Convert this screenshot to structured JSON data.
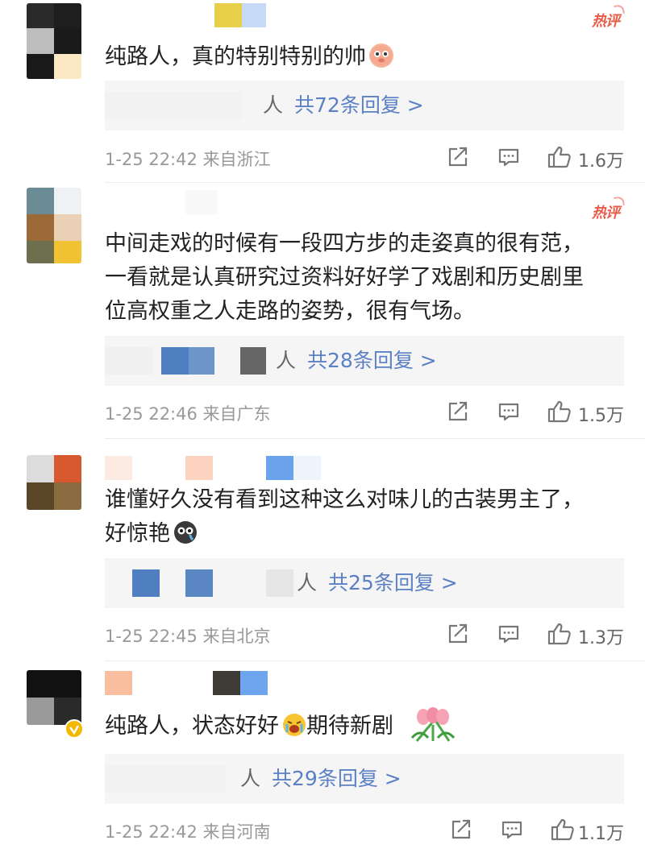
{
  "comments": [
    {
      "hot_label": "热评",
      "text_lines": [
        "纯路人，真的特别特别的帅"
      ],
      "emoji_icon": "piggy-emoji",
      "reply_name_tail": "人",
      "reply_count_text": "共72条回复 >",
      "timestamp": "1-25 22:42",
      "location": "来自浙江",
      "likes": "1.6万"
    },
    {
      "hot_label": "热评",
      "text_lines": [
        "中间走戏的时候有一段四方步的走姿真的很有范，",
        "一看就是认真研究过资料好好学了戏剧和历史剧里",
        "位高权重之人走路的姿势，很有气场。"
      ],
      "reply_name_tail": "人",
      "reply_count_text": "共28条回复 >",
      "timestamp": "1-25 22:46",
      "location": "来自广东",
      "likes": "1.5万"
    },
    {
      "text_lines": [
        "谁懂好久没有看到这种这么对味儿的古装男主了，",
        "好惊艳"
      ],
      "emoji_icon": "crying-face-emoji",
      "reply_name_tail": "人",
      "reply_count_text": "共25条回复 >",
      "timestamp": "1-25 22:45",
      "location": "来自北京",
      "likes": "1.3万"
    },
    {
      "text_part1": "纯路人，状态好好",
      "text_part2": "期待新剧",
      "emoji_icon": "crying-face-emoji",
      "reply_name_tail": "人",
      "reply_count_text": "共29条回复 >",
      "timestamp": "1-25 22:42",
      "location": "来自河南",
      "likes": "1.1万"
    }
  ],
  "colors": {
    "link_blue": "#5b80c4",
    "hot_red": "#e85c4a",
    "meta_gray": "#999999",
    "reply_bg": "#f5f5f5"
  },
  "icons": [
    "share-icon",
    "comment-icon",
    "like-icon",
    "verified-badge-icon",
    "tulip-sticker"
  ]
}
